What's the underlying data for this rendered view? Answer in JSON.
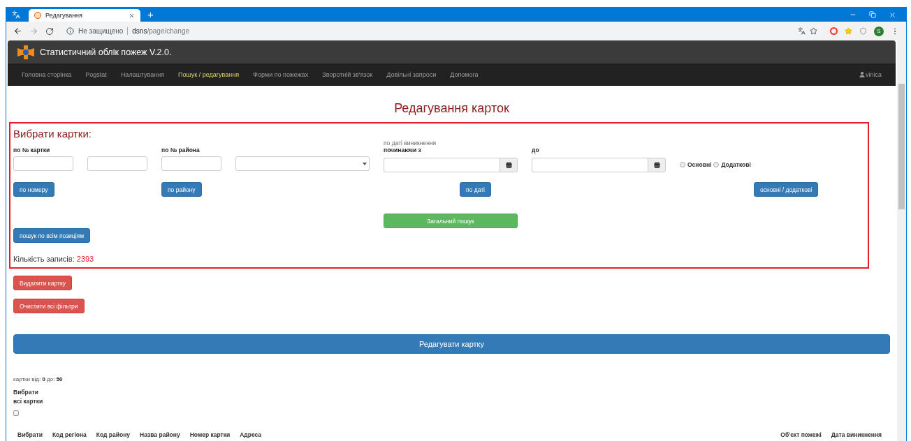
{
  "browser": {
    "tabs": [
      {
        "title": "Редагування",
        "selected": true
      }
    ],
    "new_tab": "+",
    "address": {
      "security": "Не защищено",
      "host": "dsns",
      "path": "/page/change"
    },
    "avatar": "S"
  },
  "app": {
    "title": "Статистичний облік пожеж V.2.0.",
    "nav": [
      {
        "label": "Головна сторінка",
        "selected": false
      },
      {
        "label": "Pogstat",
        "selected": false
      },
      {
        "label": "Налаштування",
        "selected": false
      },
      {
        "label": "Пошук / редагування",
        "selected": true
      },
      {
        "label": "Форми по пожежах",
        "selected": false
      },
      {
        "label": "Зворотній зв'язок",
        "selected": false
      },
      {
        "label": "Довільні запроси",
        "selected": false
      },
      {
        "label": "Допомога",
        "selected": false
      }
    ],
    "user": "vinica"
  },
  "heading": "Редагування карток",
  "filter_panel": {
    "title": "Вибрати картки:",
    "card_number_label": "по № картки",
    "district_label": "по № района",
    "date_label": "по даті виникнення",
    "from_label": "починаючи з",
    "to_label": "до",
    "radios": [
      {
        "label": "Основні",
        "selected": false
      },
      {
        "label": "Додаткові",
        "selected": false
      }
    ],
    "by_number_button": "по номеру",
    "by_district_button": "по району",
    "by_date_button": "по даті",
    "type_button": "основні / додаткові",
    "general_search_button": "Загальний пошук",
    "all_positions_button": "пошук по всім позиціям",
    "count_label": "Кількість записів:",
    "count_value": "2393"
  },
  "delete_button": "Видалити картку",
  "clear_button": "Очистити всі фільтри",
  "edit_button": "Редагувати картку",
  "range_text": "картки від: **0** до: **50**",
  "select_all": {
    "label_line_1": "Вибрати",
    "label_line_2": "всі картки",
    "checked": false
  },
  "table": {
    "columns": [
      "Вибрати",
      "Код регіона",
      "Код району",
      "Назва району",
      "Номер картки",
      "Адреса",
      "Об'єкт пожежі",
      "Дата виникнення"
    ]
  }
}
